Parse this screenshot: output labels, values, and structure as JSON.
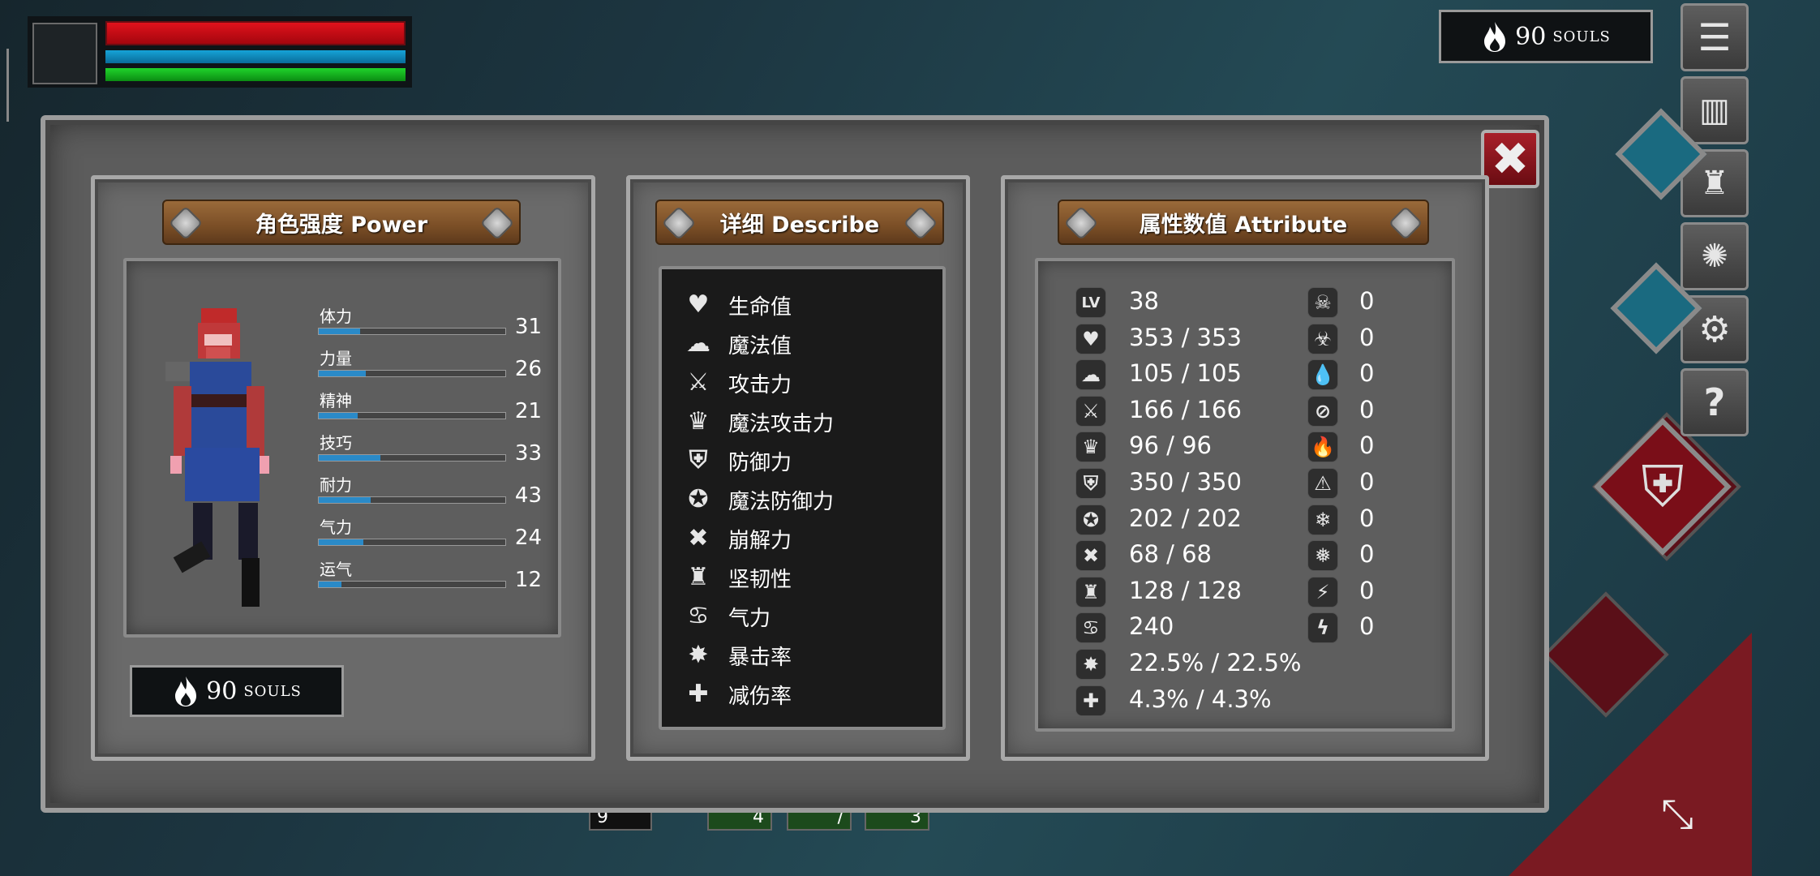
{
  "hud": {
    "souls_count": "90",
    "souls_label": "SOULS"
  },
  "panel": {
    "power_title": "角色强度 Power",
    "describe_title": "详细 Describe",
    "attribute_title": "属性数值 Attribute",
    "souls_count": "90",
    "souls_label": "SOULS"
  },
  "stats": [
    {
      "label": "体力",
      "value": "31",
      "fill": 0.22
    },
    {
      "label": "力量",
      "value": "26",
      "fill": 0.25
    },
    {
      "label": "精神",
      "value": "21",
      "fill": 0.21
    },
    {
      "label": "技巧",
      "value": "33",
      "fill": 0.33
    },
    {
      "label": "耐力",
      "value": "43",
      "fill": 0.28
    },
    {
      "label": "气力",
      "value": "24",
      "fill": 0.24
    },
    {
      "label": "运气",
      "value": "12",
      "fill": 0.12
    }
  ],
  "describe": [
    {
      "icon": "heart-icon",
      "glyph": "♥",
      "label": "生命值"
    },
    {
      "icon": "brain-icon",
      "glyph": "☁",
      "label": "魔法值"
    },
    {
      "icon": "sword-icon",
      "glyph": "⚔",
      "label": "攻击力"
    },
    {
      "icon": "magic-attack-icon",
      "glyph": "♛",
      "label": "魔法攻击力"
    },
    {
      "icon": "shield-icon",
      "glyph": "⛨",
      "label": "防御力"
    },
    {
      "icon": "magic-shield-icon",
      "glyph": "✪",
      "label": "魔法防御力"
    },
    {
      "icon": "break-icon",
      "glyph": "✖",
      "label": "崩解力"
    },
    {
      "icon": "helmet-icon",
      "glyph": "♜",
      "label": "坚韧性"
    },
    {
      "icon": "lungs-icon",
      "glyph": "♋",
      "label": "气力"
    },
    {
      "icon": "critical-icon",
      "glyph": "✸",
      "label": "暴击率"
    },
    {
      "icon": "damage-reduction-icon",
      "glyph": "✚",
      "label": "减伤率"
    }
  ],
  "attributes_left": [
    {
      "icon": "level-icon",
      "glyph": "LV",
      "value": "38"
    },
    {
      "icon": "heart-icon",
      "glyph": "♥",
      "value": "353 / 353"
    },
    {
      "icon": "brain-icon",
      "glyph": "☁",
      "value": "105 / 105"
    },
    {
      "icon": "sword-icon",
      "glyph": "⚔",
      "value": "166 / 166"
    },
    {
      "icon": "magic-attack-icon",
      "glyph": "♛",
      "value": "96 / 96"
    },
    {
      "icon": "shield-icon",
      "glyph": "⛨",
      "value": "350 / 350"
    },
    {
      "icon": "magic-shield-icon",
      "glyph": "✪",
      "value": "202 / 202"
    },
    {
      "icon": "break-icon",
      "glyph": "✖",
      "value": "68 / 68"
    },
    {
      "icon": "helmet-icon",
      "glyph": "♜",
      "value": "128 / 128"
    },
    {
      "icon": "lungs-icon",
      "glyph": "♋",
      "value": "240"
    },
    {
      "icon": "critical-icon",
      "glyph": "✸",
      "value": "22.5% / 22.5%"
    },
    {
      "icon": "damage-reduction-icon",
      "glyph": "✚",
      "value": "4.3% / 4.3%"
    }
  ],
  "attributes_right": [
    {
      "icon": "poison-icon",
      "glyph": "☠",
      "value": "0"
    },
    {
      "icon": "poison-resist-icon",
      "glyph": "☣",
      "value": "0"
    },
    {
      "icon": "bleed-icon",
      "glyph": "💧",
      "value": "0"
    },
    {
      "icon": "bleed-resist-icon",
      "glyph": "⊘",
      "value": "0"
    },
    {
      "icon": "fire-icon",
      "glyph": "🔥",
      "value": "0"
    },
    {
      "icon": "fire-resist-icon",
      "glyph": "⚠",
      "value": "0"
    },
    {
      "icon": "frost-icon",
      "glyph": "❄",
      "value": "0"
    },
    {
      "icon": "frost-resist-icon",
      "glyph": "❅",
      "value": "0"
    },
    {
      "icon": "lightning-icon",
      "glyph": "⚡",
      "value": "0"
    },
    {
      "icon": "lightning-resist-icon",
      "glyph": "ϟ",
      "value": "0"
    }
  ],
  "bottom_hud": [
    {
      "value": "9"
    },
    {
      "value": "4"
    },
    {
      "value": "/"
    },
    {
      "value": "3"
    }
  ]
}
